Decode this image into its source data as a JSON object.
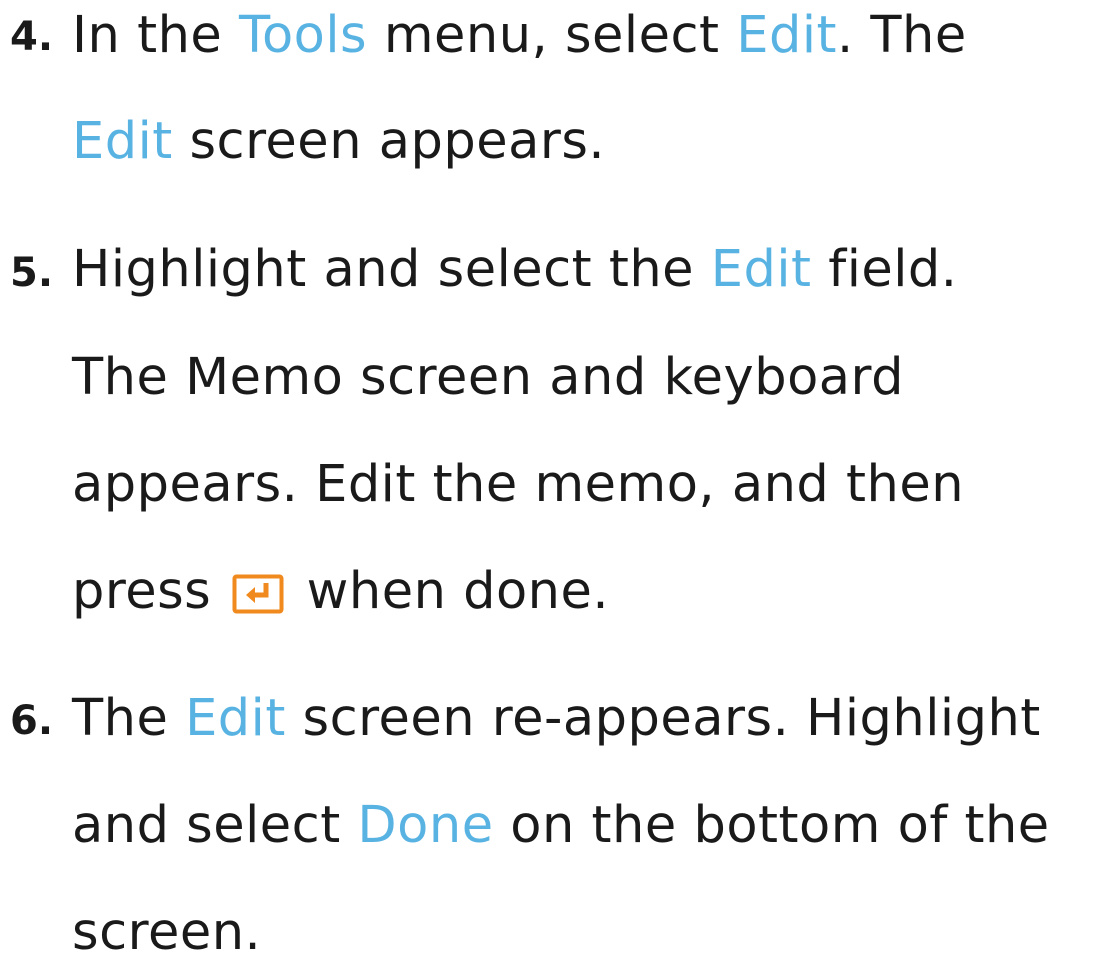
{
  "steps": [
    {
      "number": "4.",
      "lines": [
        [
          {
            "text": "In the ",
            "hl": false
          },
          {
            "text": "Tools",
            "hl": true
          },
          {
            "text": " menu, select ",
            "hl": false
          },
          {
            "text": "Edit",
            "hl": true
          },
          {
            "text": ". The",
            "hl": false
          }
        ],
        [
          {
            "text": "Edit",
            "hl": true
          },
          {
            "text": " screen appears.",
            "hl": false
          }
        ]
      ]
    },
    {
      "number": "5.",
      "lines": [
        [
          {
            "text": "Highlight and select the ",
            "hl": false
          },
          {
            "text": "Edit",
            "hl": true
          },
          {
            "text": " field.",
            "hl": false
          }
        ],
        [
          {
            "text": "The Memo screen and keyboard",
            "hl": false
          }
        ],
        [
          {
            "text": "appears. Edit the memo, and then",
            "hl": false
          }
        ],
        [
          {
            "text": "press ",
            "hl": false
          },
          {
            "icon": "enter-key-icon"
          },
          {
            "text": " when done.",
            "hl": false
          }
        ]
      ]
    },
    {
      "number": "6.",
      "lines": [
        [
          {
            "text": "The ",
            "hl": false
          },
          {
            "text": "Edit",
            "hl": true
          },
          {
            "text": " screen re-appears. Highlight",
            "hl": false
          }
        ],
        [
          {
            "text": "and select ",
            "hl": false
          },
          {
            "text": "Done",
            "hl": true
          },
          {
            "text": " on the bottom of the",
            "hl": false
          }
        ],
        [
          {
            "text": "screen.",
            "hl": false
          }
        ]
      ]
    }
  ],
  "colors": {
    "highlight": "#58b3e3",
    "text": "#1a1a1a",
    "icon": "#f08a1e"
  }
}
